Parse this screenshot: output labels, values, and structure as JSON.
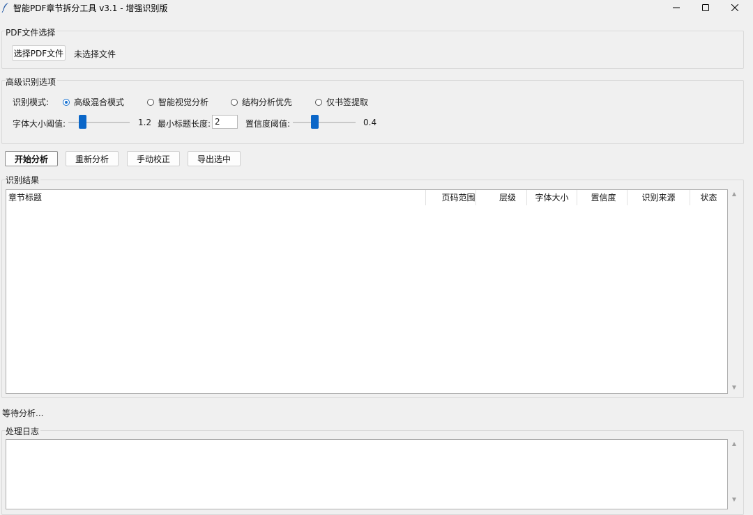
{
  "window": {
    "title": "智能PDF章节拆分工具 v3.1 - 增强识别版",
    "controls": {
      "minimize": "—",
      "maximize": "☐",
      "close": "✕"
    }
  },
  "file_section": {
    "label": "PDF文件选择",
    "choose_button": "选择PDF文件",
    "file_status": "未选择文件"
  },
  "options_section": {
    "label": "高级识别选项",
    "mode_label": "识别模式:",
    "modes": [
      {
        "label": "高级混合模式",
        "selected": true
      },
      {
        "label": "智能视觉分析",
        "selected": false
      },
      {
        "label": "结构分析优先",
        "selected": false
      },
      {
        "label": "仅书签提取",
        "selected": false
      }
    ],
    "font_threshold_label": "字体大小阈值:",
    "font_threshold_value": "1.2",
    "min_title_label": "最小标题长度:",
    "min_title_value": "2",
    "confidence_label": "置信度阈值:",
    "confidence_value": "0.4"
  },
  "actions": {
    "start": "开始分析",
    "reanalyze": "重新分析",
    "manual": "手动校正",
    "export": "导出选中"
  },
  "results": {
    "label": "识别结果",
    "columns": [
      "章节标题",
      "页码范围",
      "层级",
      "字体大小",
      "置信度",
      "识别来源",
      "状态"
    ],
    "rows": []
  },
  "status_text": "等待分析...",
  "log": {
    "label": "处理日志",
    "content": ""
  },
  "colors": {
    "accent": "#0a66c8",
    "background": "#f0f0f0"
  }
}
